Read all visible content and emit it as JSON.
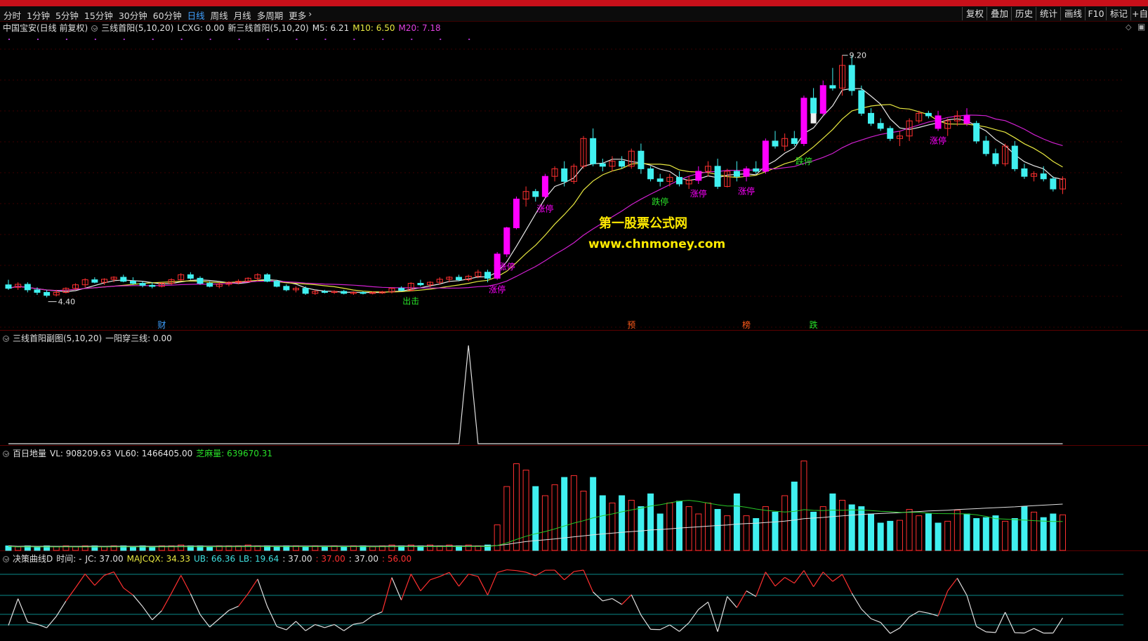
{
  "periods": [
    "分时",
    "1分钟",
    "5分钟",
    "15分钟",
    "30分钟",
    "60分钟",
    "日线",
    "周线",
    "月线",
    "多周期",
    "更多"
  ],
  "active_period": "日线",
  "more_arrow": "›",
  "tools": [
    "复权",
    "叠加",
    "历史",
    "统计",
    "画线",
    "F10",
    "标记"
  ],
  "right_extra": "+自",
  "main": {
    "stock": "中国宝安(日线 前复权)",
    "ind1": "三线首阳(5,10,20)",
    "lcxg": "LCXG: 0.00",
    "ind2": "新三线首阳(5,10,20)",
    "m5": "M5: 6.21",
    "m10": "M10: 6.50",
    "m20": "M20: 7.18",
    "high_label": "9.20",
    "low_label": "4.40",
    "annotations": [
      {
        "text": "涨停",
        "i": 51
      },
      {
        "text": "涨停",
        "i": 52
      },
      {
        "text": "涨停",
        "i": 56
      },
      {
        "text": "跌停",
        "i": 68
      },
      {
        "text": "涨停",
        "i": 72
      },
      {
        "text": "涨停",
        "i": 77
      },
      {
        "text": "跌停",
        "i": 83
      },
      {
        "text": "涨停",
        "i": 97
      },
      {
        "text": "出击",
        "i": 42
      }
    ],
    "markers": [
      {
        "text": "财",
        "i": 16,
        "color": "#3fa0ff"
      },
      {
        "text": "预",
        "i": 65,
        "color": "#ff5a1a"
      },
      {
        "text": "榜",
        "i": 77,
        "color": "#ff5a1a"
      },
      {
        "text": "跌",
        "i": 84,
        "color": "#28e028"
      }
    ],
    "watermark1": "第一股票公式网",
    "watermark2": "www.chnmoney.com"
  },
  "sub1": {
    "name": "三线首阳副图(5,10,20)",
    "value": "一阳穿三线: 0.00"
  },
  "sub2": {
    "name": "百日地量",
    "vl": "VL: 908209.63",
    "vl60": "VL60: 1466405.00",
    "zm": "芝麻量: 639670.31"
  },
  "sub3": {
    "name": "决策曲线D",
    "time": "时间: -",
    "jc": "JC: 37.00",
    "majcqx": "MAJCQX: 34.33",
    "ub": "UB: 66.36",
    "lb": "LB: 19.64",
    "v1": ": 37.00",
    "v2": ": 37.00",
    "v3": ": 37.00",
    "v4": ": 56.00"
  },
  "colors": {
    "up": "#ff3030",
    "down": "#40f0f0",
    "limit": "#ff00ff",
    "m5": "#e8e8e8",
    "m10": "#e8e840",
    "m20": "#d020d0"
  },
  "chart_data": {
    "type": "candlestick",
    "ylim": [
      4.2,
      9.6
    ],
    "candles": [
      [
        4.65,
        4.75,
        4.55,
        4.58
      ],
      [
        4.6,
        4.7,
        4.55,
        4.66
      ],
      [
        4.66,
        4.7,
        4.5,
        4.55
      ],
      [
        4.55,
        4.6,
        4.45,
        4.5
      ],
      [
        4.5,
        4.55,
        4.4,
        4.44
      ],
      [
        4.45,
        4.55,
        4.42,
        4.5
      ],
      [
        4.5,
        4.6,
        4.48,
        4.58
      ],
      [
        4.58,
        4.68,
        4.55,
        4.65
      ],
      [
        4.65,
        4.78,
        4.6,
        4.75
      ],
      [
        4.75,
        4.8,
        4.68,
        4.7
      ],
      [
        4.7,
        4.78,
        4.65,
        4.76
      ],
      [
        4.76,
        4.82,
        4.7,
        4.8
      ],
      [
        4.8,
        4.85,
        4.7,
        4.72
      ],
      [
        4.72,
        4.8,
        4.65,
        4.68
      ],
      [
        4.68,
        4.72,
        4.6,
        4.64
      ],
      [
        4.64,
        4.7,
        4.58,
        4.62
      ],
      [
        4.62,
        4.7,
        4.6,
        4.68
      ],
      [
        4.68,
        4.78,
        4.65,
        4.75
      ],
      [
        4.75,
        4.88,
        4.72,
        4.85
      ],
      [
        4.85,
        4.9,
        4.75,
        4.78
      ],
      [
        4.78,
        4.82,
        4.65,
        4.68
      ],
      [
        4.68,
        4.72,
        4.6,
        4.62
      ],
      [
        4.62,
        4.7,
        4.58,
        4.66
      ],
      [
        4.66,
        4.72,
        4.62,
        4.7
      ],
      [
        4.7,
        4.76,
        4.66,
        4.72
      ],
      [
        4.72,
        4.8,
        4.7,
        4.78
      ],
      [
        4.78,
        4.88,
        4.72,
        4.85
      ],
      [
        4.85,
        4.88,
        4.7,
        4.72
      ],
      [
        4.72,
        4.75,
        4.6,
        4.62
      ],
      [
        4.62,
        4.66,
        4.52,
        4.55
      ],
      [
        4.55,
        4.62,
        4.5,
        4.58
      ],
      [
        4.58,
        4.62,
        4.45,
        4.48
      ],
      [
        4.48,
        4.55,
        4.45,
        4.52
      ],
      [
        4.52,
        4.55,
        4.48,
        4.5
      ],
      [
        4.5,
        4.54,
        4.47,
        4.52
      ],
      [
        4.52,
        4.55,
        4.46,
        4.48
      ],
      [
        4.48,
        4.52,
        4.45,
        4.5
      ],
      [
        4.5,
        4.52,
        4.46,
        4.49
      ],
      [
        4.49,
        4.52,
        4.46,
        4.5
      ],
      [
        4.5,
        4.53,
        4.47,
        4.51
      ],
      [
        4.51,
        4.6,
        4.48,
        4.58
      ],
      [
        4.58,
        4.62,
        4.52,
        4.54
      ],
      [
        4.54,
        4.7,
        4.52,
        4.68
      ],
      [
        4.68,
        4.75,
        4.62,
        4.65
      ],
      [
        4.65,
        4.72,
        4.6,
        4.7
      ],
      [
        4.7,
        4.8,
        4.65,
        4.76
      ],
      [
        4.76,
        4.82,
        4.7,
        4.8
      ],
      [
        4.8,
        4.85,
        4.72,
        4.75
      ],
      [
        4.75,
        4.85,
        4.72,
        4.82
      ],
      [
        4.82,
        4.95,
        4.78,
        4.9
      ],
      [
        4.9,
        4.95,
        4.7,
        4.78
      ],
      [
        4.78,
        5.3,
        4.75,
        5.26
      ],
      [
        5.26,
        5.8,
        5.2,
        5.78
      ],
      [
        5.78,
        6.4,
        5.75,
        6.35
      ],
      [
        6.35,
        6.6,
        6.2,
        6.5
      ],
      [
        6.5,
        6.55,
        6.3,
        6.4
      ],
      [
        6.4,
        6.85,
        6.35,
        6.8
      ],
      [
        6.8,
        7.0,
        6.7,
        6.95
      ],
      [
        6.95,
        7.1,
        6.6,
        6.7
      ],
      [
        6.7,
        7.05,
        6.65,
        7.0
      ],
      [
        7.0,
        7.6,
        6.95,
        7.55
      ],
      [
        7.55,
        7.75,
        7.0,
        7.05
      ],
      [
        7.05,
        7.15,
        6.9,
        7.0
      ],
      [
        7.0,
        7.2,
        6.9,
        7.1
      ],
      [
        7.1,
        7.2,
        6.95,
        7.0
      ],
      [
        7.0,
        7.35,
        6.95,
        7.3
      ],
      [
        7.3,
        7.45,
        6.85,
        6.95
      ],
      [
        6.95,
        7.0,
        6.7,
        6.75
      ],
      [
        6.75,
        6.85,
        6.6,
        6.7
      ],
      [
        6.7,
        6.85,
        6.6,
        6.78
      ],
      [
        6.78,
        6.9,
        6.6,
        6.65
      ],
      [
        6.65,
        6.8,
        6.55,
        6.72
      ],
      [
        6.72,
        7.0,
        6.65,
        6.9
      ],
      [
        6.9,
        7.1,
        6.8,
        7.0
      ],
      [
        7.0,
        7.15,
        6.55,
        6.6
      ],
      [
        6.6,
        6.95,
        6.58,
        6.9
      ],
      [
        6.9,
        7.1,
        6.7,
        6.8
      ],
      [
        6.8,
        7.0,
        6.7,
        6.95
      ],
      [
        6.95,
        7.1,
        6.85,
        6.9
      ],
      [
        6.9,
        7.55,
        6.85,
        7.5
      ],
      [
        7.5,
        7.7,
        7.35,
        7.4
      ],
      [
        7.4,
        7.65,
        7.3,
        7.55
      ],
      [
        7.55,
        7.7,
        7.4,
        7.45
      ],
      [
        7.45,
        8.4,
        7.4,
        8.35
      ],
      [
        8.35,
        8.55,
        8.0,
        8.05
      ],
      [
        8.05,
        8.7,
        8.0,
        8.6
      ],
      [
        8.6,
        8.95,
        8.5,
        8.55
      ],
      [
        8.55,
        9.2,
        8.4,
        9.0
      ],
      [
        9.0,
        9.2,
        8.4,
        8.5
      ],
      [
        8.5,
        8.6,
        8.0,
        8.05
      ],
      [
        8.05,
        8.15,
        7.8,
        7.85
      ],
      [
        7.85,
        7.95,
        7.7,
        7.75
      ],
      [
        7.75,
        7.8,
        7.5,
        7.55
      ],
      [
        7.55,
        7.7,
        7.4,
        7.6
      ],
      [
        7.6,
        7.95,
        7.5,
        7.9
      ],
      [
        7.9,
        8.1,
        7.85,
        8.05
      ],
      [
        8.05,
        8.1,
        7.95,
        8.0
      ],
      [
        8.0,
        8.1,
        7.7,
        7.75
      ],
      [
        7.75,
        7.95,
        7.6,
        7.9
      ],
      [
        7.9,
        8.1,
        7.8,
        8.0
      ],
      [
        8.0,
        8.15,
        7.8,
        7.85
      ],
      [
        7.85,
        7.9,
        7.45,
        7.5
      ],
      [
        7.5,
        7.6,
        7.2,
        7.25
      ],
      [
        7.25,
        7.35,
        7.0,
        7.05
      ],
      [
        7.05,
        7.45,
        7.0,
        7.4
      ],
      [
        7.4,
        7.5,
        6.9,
        6.95
      ],
      [
        6.95,
        7.05,
        6.75,
        6.8
      ],
      [
        6.8,
        6.9,
        6.7,
        6.85
      ],
      [
        6.85,
        7.0,
        6.7,
        6.75
      ],
      [
        6.75,
        6.8,
        6.5,
        6.55
      ],
      [
        6.55,
        6.8,
        6.45,
        6.75
      ]
    ],
    "limit_bars": [
      51,
      52,
      53,
      56,
      72,
      77,
      79,
      83,
      85,
      97,
      100
    ],
    "volumes": [
      5,
      4,
      5,
      4,
      5,
      4,
      5,
      4,
      5,
      5,
      4,
      5,
      5,
      4,
      5,
      4,
      5,
      5,
      6,
      5,
      5,
      4,
      5,
      5,
      5,
      6,
      5,
      5,
      4,
      5,
      5,
      4,
      5,
      4,
      5,
      4,
      5,
      5,
      4,
      5,
      6,
      5,
      6,
      5,
      6,
      5,
      6,
      5,
      6,
      5,
      6,
      28,
      70,
      95,
      88,
      70,
      60,
      72,
      80,
      82,
      65,
      80,
      60,
      52,
      60,
      55,
      48,
      62,
      40,
      52,
      54,
      48,
      40,
      52,
      45,
      38,
      62,
      38,
      35,
      48,
      42,
      60,
      75,
      98,
      42,
      48,
      62,
      55,
      50,
      48,
      40,
      30,
      32,
      33,
      45,
      38,
      40,
      30,
      32,
      44,
      40,
      35,
      36,
      38,
      32,
      35,
      48,
      42,
      36,
      40,
      39
    ]
  }
}
